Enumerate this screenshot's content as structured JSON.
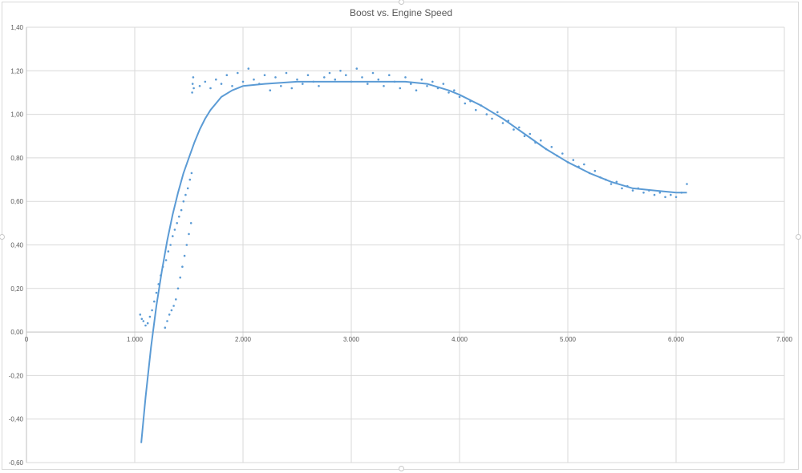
{
  "chart_data": {
    "type": "scatter",
    "title": "Boost vs. Engine Speed",
    "xlabel": "",
    "ylabel": "",
    "xlim": [
      0,
      7000
    ],
    "ylim": [
      -0.6,
      1.4
    ],
    "x_ticks": [
      0,
      1000,
      2000,
      3000,
      4000,
      5000,
      6000,
      7000
    ],
    "x_tick_labels": [
      "0",
      "1.000",
      "2.000",
      "3.000",
      "4.000",
      "5.000",
      "6.000",
      "7.000"
    ],
    "y_ticks": [
      1.4,
      1.2,
      1.0,
      0.8,
      0.6,
      0.4,
      0.2,
      0.0,
      -0.2,
      -0.4,
      -0.6
    ],
    "y_tick_labels": [
      "1,40",
      "1,20",
      "1,00",
      "0,80",
      "0,60",
      "0,40",
      "0,20",
      "0,00",
      "-0,20",
      "-0,40",
      "-0,60"
    ],
    "grid": true,
    "legend": "none",
    "series_color": "#5b9bd5",
    "series": [
      {
        "points": [
          [
            1050,
            0.08
          ],
          [
            1065,
            0.06
          ],
          [
            1080,
            0.05
          ],
          [
            1100,
            0.03
          ],
          [
            1120,
            0.04
          ],
          [
            1140,
            0.07
          ],
          [
            1160,
            0.1
          ],
          [
            1180,
            0.14
          ],
          [
            1200,
            0.18
          ],
          [
            1220,
            0.22
          ],
          [
            1240,
            0.26
          ],
          [
            1260,
            0.3
          ],
          [
            1280,
            0.02
          ],
          [
            1290,
            0.33
          ],
          [
            1300,
            0.05
          ],
          [
            1310,
            0.37
          ],
          [
            1320,
            0.08
          ],
          [
            1330,
            0.4
          ],
          [
            1340,
            0.1
          ],
          [
            1350,
            0.44
          ],
          [
            1360,
            0.12
          ],
          [
            1370,
            0.47
          ],
          [
            1380,
            0.15
          ],
          [
            1390,
            0.5
          ],
          [
            1400,
            0.2
          ],
          [
            1410,
            0.53
          ],
          [
            1420,
            0.25
          ],
          [
            1430,
            0.56
          ],
          [
            1440,
            0.3
          ],
          [
            1450,
            0.6
          ],
          [
            1460,
            0.35
          ],
          [
            1470,
            0.63
          ],
          [
            1480,
            0.4
          ],
          [
            1490,
            0.66
          ],
          [
            1500,
            0.45
          ],
          [
            1510,
            0.7
          ],
          [
            1520,
            0.5
          ],
          [
            1525,
            0.73
          ],
          [
            1530,
            1.1
          ],
          [
            1535,
            1.14
          ],
          [
            1540,
            1.17
          ],
          [
            1545,
            1.12
          ],
          [
            1600,
            1.13
          ],
          [
            1650,
            1.15
          ],
          [
            1700,
            1.12
          ],
          [
            1750,
            1.16
          ],
          [
            1800,
            1.14
          ],
          [
            1850,
            1.18
          ],
          [
            1900,
            1.13
          ],
          [
            1950,
            1.19
          ],
          [
            2000,
            1.15
          ],
          [
            2050,
            1.21
          ],
          [
            2100,
            1.16
          ],
          [
            2150,
            1.14
          ],
          [
            2200,
            1.18
          ],
          [
            2250,
            1.11
          ],
          [
            2300,
            1.17
          ],
          [
            2350,
            1.13
          ],
          [
            2400,
            1.19
          ],
          [
            2450,
            1.12
          ],
          [
            2500,
            1.16
          ],
          [
            2550,
            1.14
          ],
          [
            2600,
            1.18
          ],
          [
            2650,
            1.15
          ],
          [
            2700,
            1.13
          ],
          [
            2750,
            1.17
          ],
          [
            2800,
            1.19
          ],
          [
            2850,
            1.16
          ],
          [
            2900,
            1.2
          ],
          [
            2950,
            1.18
          ],
          [
            3000,
            1.15
          ],
          [
            3050,
            1.21
          ],
          [
            3100,
            1.17
          ],
          [
            3150,
            1.14
          ],
          [
            3200,
            1.19
          ],
          [
            3250,
            1.16
          ],
          [
            3300,
            1.13
          ],
          [
            3350,
            1.18
          ],
          [
            3400,
            1.15
          ],
          [
            3450,
            1.12
          ],
          [
            3500,
            1.17
          ],
          [
            3550,
            1.14
          ],
          [
            3600,
            1.11
          ],
          [
            3650,
            1.16
          ],
          [
            3700,
            1.13
          ],
          [
            3750,
            1.15
          ],
          [
            3800,
            1.12
          ],
          [
            3850,
            1.14
          ],
          [
            3900,
            1.1
          ],
          [
            3950,
            1.11
          ],
          [
            4000,
            1.08
          ],
          [
            4050,
            1.05
          ],
          [
            4100,
            1.06
          ],
          [
            4150,
            1.02
          ],
          [
            4200,
            1.04
          ],
          [
            4250,
            1.0
          ],
          [
            4300,
            0.98
          ],
          [
            4350,
            1.01
          ],
          [
            4400,
            0.96
          ],
          [
            4450,
            0.97
          ],
          [
            4500,
            0.93
          ],
          [
            4550,
            0.94
          ],
          [
            4600,
            0.9
          ],
          [
            4650,
            0.91
          ],
          [
            4700,
            0.87
          ],
          [
            4750,
            0.88
          ],
          [
            4800,
            0.84
          ],
          [
            4850,
            0.85
          ],
          [
            4900,
            0.81
          ],
          [
            4950,
            0.82
          ],
          [
            5000,
            0.78
          ],
          [
            5050,
            0.79
          ],
          [
            5100,
            0.76
          ],
          [
            5150,
            0.77
          ],
          [
            5200,
            0.73
          ],
          [
            5250,
            0.74
          ],
          [
            5300,
            0.71
          ],
          [
            5350,
            0.7
          ],
          [
            5400,
            0.68
          ],
          [
            5450,
            0.69
          ],
          [
            5500,
            0.66
          ],
          [
            5550,
            0.67
          ],
          [
            5600,
            0.65
          ],
          [
            5650,
            0.66
          ],
          [
            5700,
            0.64
          ],
          [
            5750,
            0.65
          ],
          [
            5800,
            0.63
          ],
          [
            5850,
            0.64
          ],
          [
            5900,
            0.62
          ],
          [
            5950,
            0.63
          ],
          [
            6000,
            0.62
          ],
          [
            6050,
            0.64
          ],
          [
            6100,
            0.68
          ]
        ]
      }
    ],
    "trendline": {
      "type": "polynomial",
      "points": [
        [
          1060,
          -0.51
        ],
        [
          1100,
          -0.3
        ],
        [
          1150,
          -0.07
        ],
        [
          1200,
          0.12
        ],
        [
          1250,
          0.28
        ],
        [
          1300,
          0.42
        ],
        [
          1350,
          0.54
        ],
        [
          1400,
          0.64
        ],
        [
          1450,
          0.73
        ],
        [
          1500,
          0.8
        ],
        [
          1550,
          0.87
        ],
        [
          1600,
          0.93
        ],
        [
          1650,
          0.98
        ],
        [
          1700,
          1.02
        ],
        [
          1750,
          1.05
        ],
        [
          1800,
          1.08
        ],
        [
          1900,
          1.11
        ],
        [
          2000,
          1.13
        ],
        [
          2200,
          1.14
        ],
        [
          2500,
          1.15
        ],
        [
          3000,
          1.15
        ],
        [
          3500,
          1.15
        ],
        [
          3700,
          1.14
        ],
        [
          3900,
          1.11
        ],
        [
          4000,
          1.09
        ],
        [
          4200,
          1.04
        ],
        [
          4400,
          0.98
        ],
        [
          4600,
          0.91
        ],
        [
          4800,
          0.84
        ],
        [
          5000,
          0.78
        ],
        [
          5200,
          0.73
        ],
        [
          5400,
          0.69
        ],
        [
          5600,
          0.66
        ],
        [
          5800,
          0.65
        ],
        [
          6000,
          0.64
        ],
        [
          6100,
          0.64
        ]
      ]
    }
  }
}
